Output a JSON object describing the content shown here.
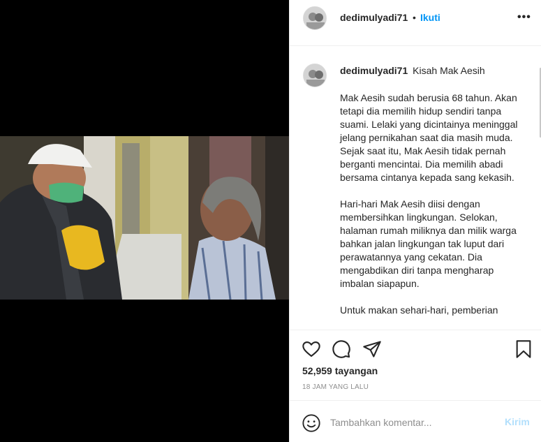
{
  "post": {
    "username": "dedimulyadi71",
    "dot": "•",
    "follow_label": "Ikuti",
    "more_icon": "more-horizontal-icon",
    "caption_title": "Kisah Mak Aesih",
    "caption_paragraphs": [
      "Mak Aesih sudah berusia 68 tahun. Akan tetapi dia memilih hidup sendiri tanpa suami. Lelaki yang dicintainya meninggal jelang pernikahan saat dia masih muda. Sejak saat itu, Mak Aesih tidak pernah berganti mencintai. Dia memilih abadi bersama cintanya kepada sang kekasih.",
      "Hari-hari Mak Aesih diisi dengan membersihkan lingkungan. Selokan, halaman rumah miliknya dan milik warga bahkan jalan lingkungan tak luput dari perawatannya yang cekatan. Dia mengabdikan diri tanpa mengharap imbalan siapapun.",
      "Untuk makan sehari-hari, pemberian"
    ],
    "views": "52,959 tayangan",
    "timestamp": "18 JAM YANG LALU"
  },
  "comment": {
    "placeholder": "Tambahkan komentar...",
    "post_label": "Kirim"
  },
  "colors": {
    "accent": "#0095f6",
    "post_disabled": "#b2dffc",
    "border": "#efefef",
    "muted": "#8e8e8e"
  }
}
